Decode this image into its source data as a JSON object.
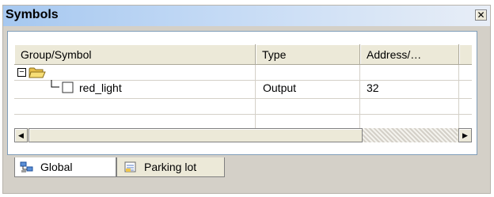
{
  "window": {
    "title": "Symbols",
    "close_glyph": "✕"
  },
  "table": {
    "columns": [
      "Group/Symbol",
      "Type",
      "Address/…"
    ],
    "rows": [
      {
        "symbol": "",
        "type": "",
        "address": "",
        "kind": "group",
        "expanded": true,
        "icon": "folder-open-icon",
        "toggle": "−"
      },
      {
        "symbol": "red_light",
        "type": "Output",
        "address": "32",
        "kind": "symbol",
        "icon": "symbol-box-icon"
      }
    ]
  },
  "scrollbar": {
    "left_glyph": "◀",
    "right_glyph": "▶"
  },
  "tabs": [
    {
      "label": "Global",
      "icon": "global-network-icon",
      "selected": true
    },
    {
      "label": "Parking lot",
      "icon": "table-page-icon",
      "selected": false
    }
  ],
  "colors": {
    "title_gradient_start": "#a6c8f0",
    "title_gradient_end": "#e8eef7",
    "window_bg": "#d4d0c8",
    "folder_yellow": "#f3d35a"
  }
}
